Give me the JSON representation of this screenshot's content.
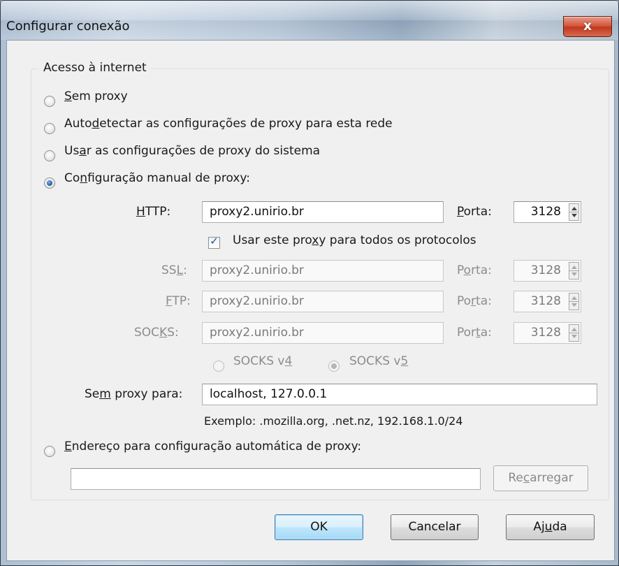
{
  "window": {
    "title": "Configurar conexão",
    "close_glyph": "x"
  },
  "group": {
    "legend": "Acesso à internet"
  },
  "radios": {
    "no_proxy": {
      "pre": "",
      "u": "S",
      "post": "em proxy",
      "checked": false
    },
    "autodetect": {
      "pre": "Auto",
      "u": "d",
      "post": "etectar as configurações de proxy para esta rede",
      "checked": false
    },
    "system": {
      "pre": "Us",
      "u": "a",
      "post": "r as configurações de proxy do sistema",
      "checked": false
    },
    "manual": {
      "pre": "Co",
      "u": "n",
      "post": "figuração manual de proxy:",
      "checked": true
    },
    "autoconfig": {
      "pre": "",
      "u": "E",
      "post": "ndereço para configuração automática de proxy:",
      "checked": false
    }
  },
  "proxy": {
    "http": {
      "label_pre": "",
      "label_u": "H",
      "label_post": "TTP:",
      "value": "proxy2.unirio.br",
      "port_pre": "",
      "port_u": "P",
      "port_post": "orta:",
      "port": "3128"
    },
    "ssl": {
      "label_pre": "SS",
      "label_u": "L",
      "label_post": ":",
      "value": "proxy2.unirio.br",
      "port_pre": "P",
      "port_u": "o",
      "port_post": "rta:",
      "port": "3128"
    },
    "ftp": {
      "label_pre": "",
      "label_u": "F",
      "label_post": "TP:",
      "value": "proxy2.unirio.br",
      "port_pre": "Po",
      "port_u": "r",
      "port_post": "ta:",
      "port": "3128"
    },
    "socks": {
      "label_pre": "SOC",
      "label_u": "K",
      "label_post": "S:",
      "value": "proxy2.unirio.br",
      "port_pre": "Por",
      "port_u": "t",
      "port_post": "a:",
      "port": "3128"
    }
  },
  "use_same": {
    "pre": "Usar este pro",
    "u": "x",
    "post": "y para todos os protocolos",
    "checked": true
  },
  "socks_version": {
    "v4": {
      "pre": "SOCKS v",
      "u": "4",
      "checked": false
    },
    "v5": {
      "pre": "SOCKS v",
      "u": "5",
      "checked": true
    }
  },
  "no_proxy_for": {
    "label_pre": "Se",
    "label_u": "m",
    "label_post": " proxy para:",
    "value": "localhost, 127.0.0.1",
    "example": "Exemplo: .mozilla.org, .net.nz, 192.168.1.0/24"
  },
  "autoconfig_url": {
    "value": ""
  },
  "buttons": {
    "reload": {
      "pre": "Re",
      "u": "c",
      "post": "arregar"
    },
    "ok": {
      "label": "OK"
    },
    "cancel": {
      "label": "Cancelar"
    },
    "help": {
      "pre": "Aj",
      "u": "u",
      "post": "da"
    }
  }
}
